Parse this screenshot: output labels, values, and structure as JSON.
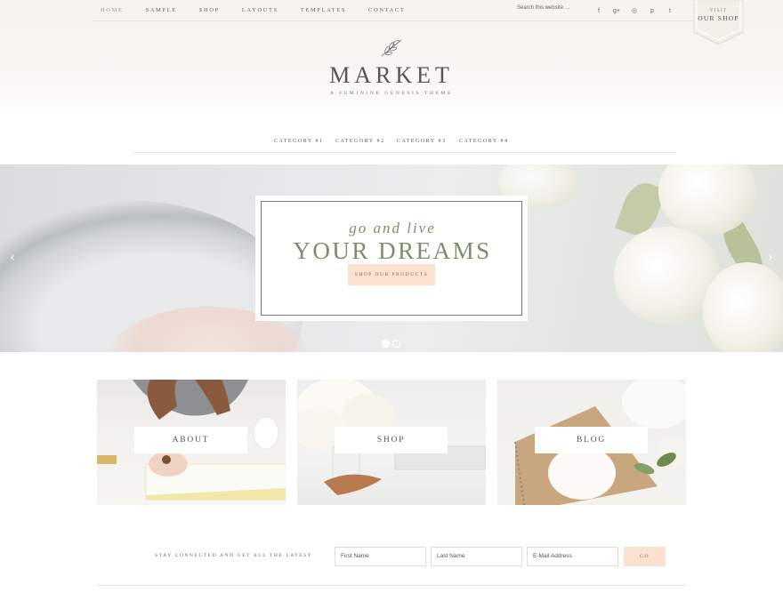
{
  "topnav": {
    "items": [
      {
        "label": "Home",
        "active": true
      },
      {
        "label": "Sample",
        "active": false
      },
      {
        "label": "Shop",
        "active": false
      },
      {
        "label": "Layouts",
        "active": false
      },
      {
        "label": "Templates",
        "active": false
      },
      {
        "label": "Contact",
        "active": false
      }
    ],
    "search_placeholder": "Search this website …",
    "social": [
      {
        "icon": "facebook-icon",
        "glyph": "f"
      },
      {
        "icon": "google-plus-icon",
        "glyph": "g+"
      },
      {
        "icon": "instagram-icon",
        "glyph": "◎"
      },
      {
        "icon": "pinterest-icon",
        "glyph": "p"
      },
      {
        "icon": "twitter-icon",
        "glyph": "t"
      }
    ]
  },
  "shop_tab": {
    "line1": "Visit",
    "line2": "Our Shop"
  },
  "logo": {
    "title": "MARKET",
    "tagline": "A Feminine Genesis Theme"
  },
  "categories": [
    "Category #1",
    "Category #2",
    "Category #3",
    "Category #4"
  ],
  "hero": {
    "script": "go and live",
    "headline": "YOUR DREAMS",
    "button": "Shop Our Products",
    "slides_total": 2,
    "slide_active": 1
  },
  "tiles": [
    {
      "label": "About"
    },
    {
      "label": "Shop"
    },
    {
      "label": "Blog"
    }
  ],
  "newsletter": {
    "text": "Stay connected and get all the latest",
    "first_name": "First Name",
    "last_name": "Last Name",
    "email": "E-Mail Address",
    "button": "Go"
  },
  "colors": {
    "accent_green": "#7b8f6b",
    "button_peach": "#fbe1cf"
  }
}
